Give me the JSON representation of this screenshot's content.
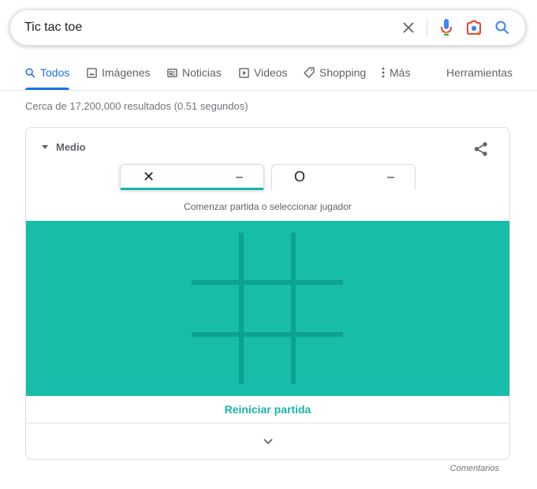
{
  "search": {
    "query": "Tic tac toe"
  },
  "tabs": [
    {
      "label": "Todos",
      "icon": "search-icon"
    },
    {
      "label": "Imágenes",
      "icon": "image-icon"
    },
    {
      "label": "Noticias",
      "icon": "news-icon"
    },
    {
      "label": "Videos",
      "icon": "video-icon"
    },
    {
      "label": "Shopping",
      "icon": "tag-icon"
    },
    {
      "label": "Más",
      "icon": "more-vert-icon"
    }
  ],
  "tools_label": "Herramientas",
  "result_stats": "Cerca de 17,200,000 resultados (0.51 segundos)",
  "game": {
    "difficulty": "Medio",
    "players": [
      {
        "mark": "✕",
        "score": "–"
      },
      {
        "mark": "O",
        "score": "–"
      }
    ],
    "status": "Comenzar partida o seleccionar jugador",
    "restart_label": "Reiniciar partida"
  },
  "feedback_label": "Comentarios",
  "colors": {
    "accent_blue": "#1a73e8",
    "board_teal": "#17bda9",
    "board_lines": "#0da192",
    "restart_text": "#1ab5a8"
  }
}
